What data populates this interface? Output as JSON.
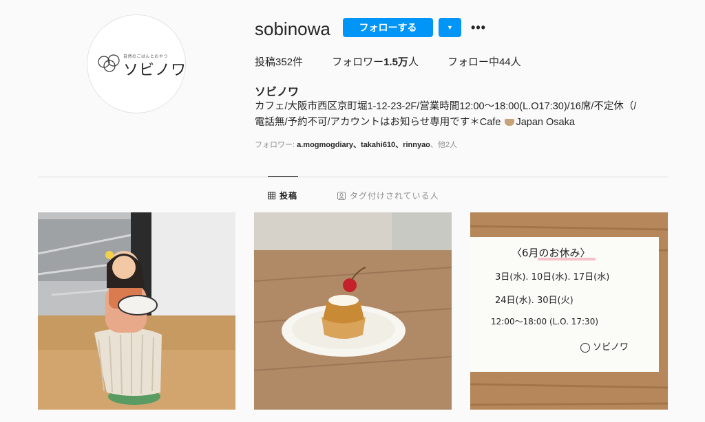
{
  "profile": {
    "avatar_tagline": "自然のごはんとおやつ",
    "avatar_logo": "ソビノワ",
    "username": "sobinowa",
    "follow_label": "フォローする",
    "dropdown_symbol": "▼",
    "more_symbol": "•••",
    "posts_label": "投稿",
    "posts_count": "352",
    "posts_suffix": "件",
    "followers_label": "フォロワー",
    "followers_count": "1.5万",
    "followers_suffix": "人",
    "following_label": "フォロー中",
    "following_count": "44",
    "following_suffix": "人",
    "full_name": "ソビノワ",
    "bio_line1": "カフェ/大阪市西区京町堀1-12-23-2F/営業時間12:00〜18:00(L.O17:30)/16席/不定休（/",
    "bio_line2a": "電話無/予約不可/アカウントはお知らせ専用です＊Cafe ",
    "bio_line2b": "Japan Osaka",
    "followed_by_label": "フォロワー: ",
    "followed_by_names": "a.mogmogdiary、takahi610、rinnyao",
    "followed_by_more": "、他2人"
  },
  "tabs": {
    "posts": "投稿",
    "tagged": "タグ付けされている人"
  },
  "posts": {
    "note": {
      "title": "〈6月のお休み〉",
      "line1": "3日(水). 10日(水). 17日(水)",
      "line2": "24日(水).  30日(火)",
      "line3": "12:00〜18:00 (L.O. 17:30)",
      "logo": "ソビノワ"
    }
  },
  "colors": {
    "accent": "#0095f6",
    "background": "#fafafa",
    "divider": "#dbdbdb"
  }
}
